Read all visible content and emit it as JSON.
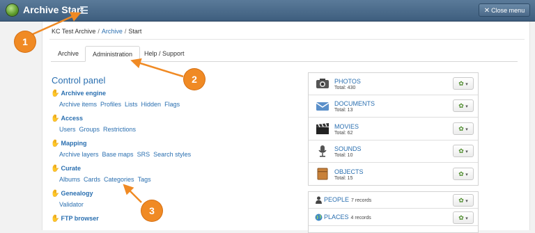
{
  "topbar": {
    "title": "Archive Start",
    "close_label": "Close menu"
  },
  "breadcrumb": {
    "root": "KC Test Archive",
    "archive": "Archive",
    "current": "Start"
  },
  "tabs": [
    {
      "label": "Archive",
      "active": false
    },
    {
      "label": "Administration",
      "active": true
    },
    {
      "label": "Help / Support",
      "active": false
    }
  ],
  "control_panel": {
    "title": "Control panel",
    "sections": [
      {
        "title": "Archive engine",
        "links": [
          "Archive items",
          "Profiles",
          "Lists",
          "Hidden",
          "Flags"
        ]
      },
      {
        "title": "Access",
        "links": [
          "Users",
          "Groups",
          "Restrictions"
        ]
      },
      {
        "title": "Mapping",
        "links": [
          "Archive layers",
          "Base maps",
          "SRS",
          "Search styles"
        ]
      },
      {
        "title": "Curate",
        "links": [
          "Albums",
          "Cards",
          "Categories",
          "Tags"
        ]
      },
      {
        "title": "Genealogy",
        "links": [
          "Validator"
        ]
      },
      {
        "title": "FTP browser",
        "links": []
      }
    ]
  },
  "media_types": [
    {
      "name": "PHOTOS",
      "total": "Total: 430",
      "icon": "camera-icon"
    },
    {
      "name": "DOCUMENTS",
      "total": "Total: 13",
      "icon": "envelope-icon"
    },
    {
      "name": "MOVIES",
      "total": "Total: 62",
      "icon": "clapperboard-icon"
    },
    {
      "name": "SOUNDS",
      "total": "Total: 10",
      "icon": "microphone-icon"
    },
    {
      "name": "OBJECTS",
      "total": "Total: 15",
      "icon": "box-icon"
    }
  ],
  "records": [
    {
      "name": "PEOPLE",
      "count": "7 records",
      "icon": "person-icon"
    },
    {
      "name": "PLACES",
      "count": "4 records",
      "icon": "globe-icon"
    }
  ],
  "callouts": [
    "1",
    "2",
    "3"
  ],
  "colors": {
    "topbar": "#4a6a8a",
    "link": "#2a6fb0",
    "callout": "#f08a24",
    "gear": "#4c8b2a"
  }
}
